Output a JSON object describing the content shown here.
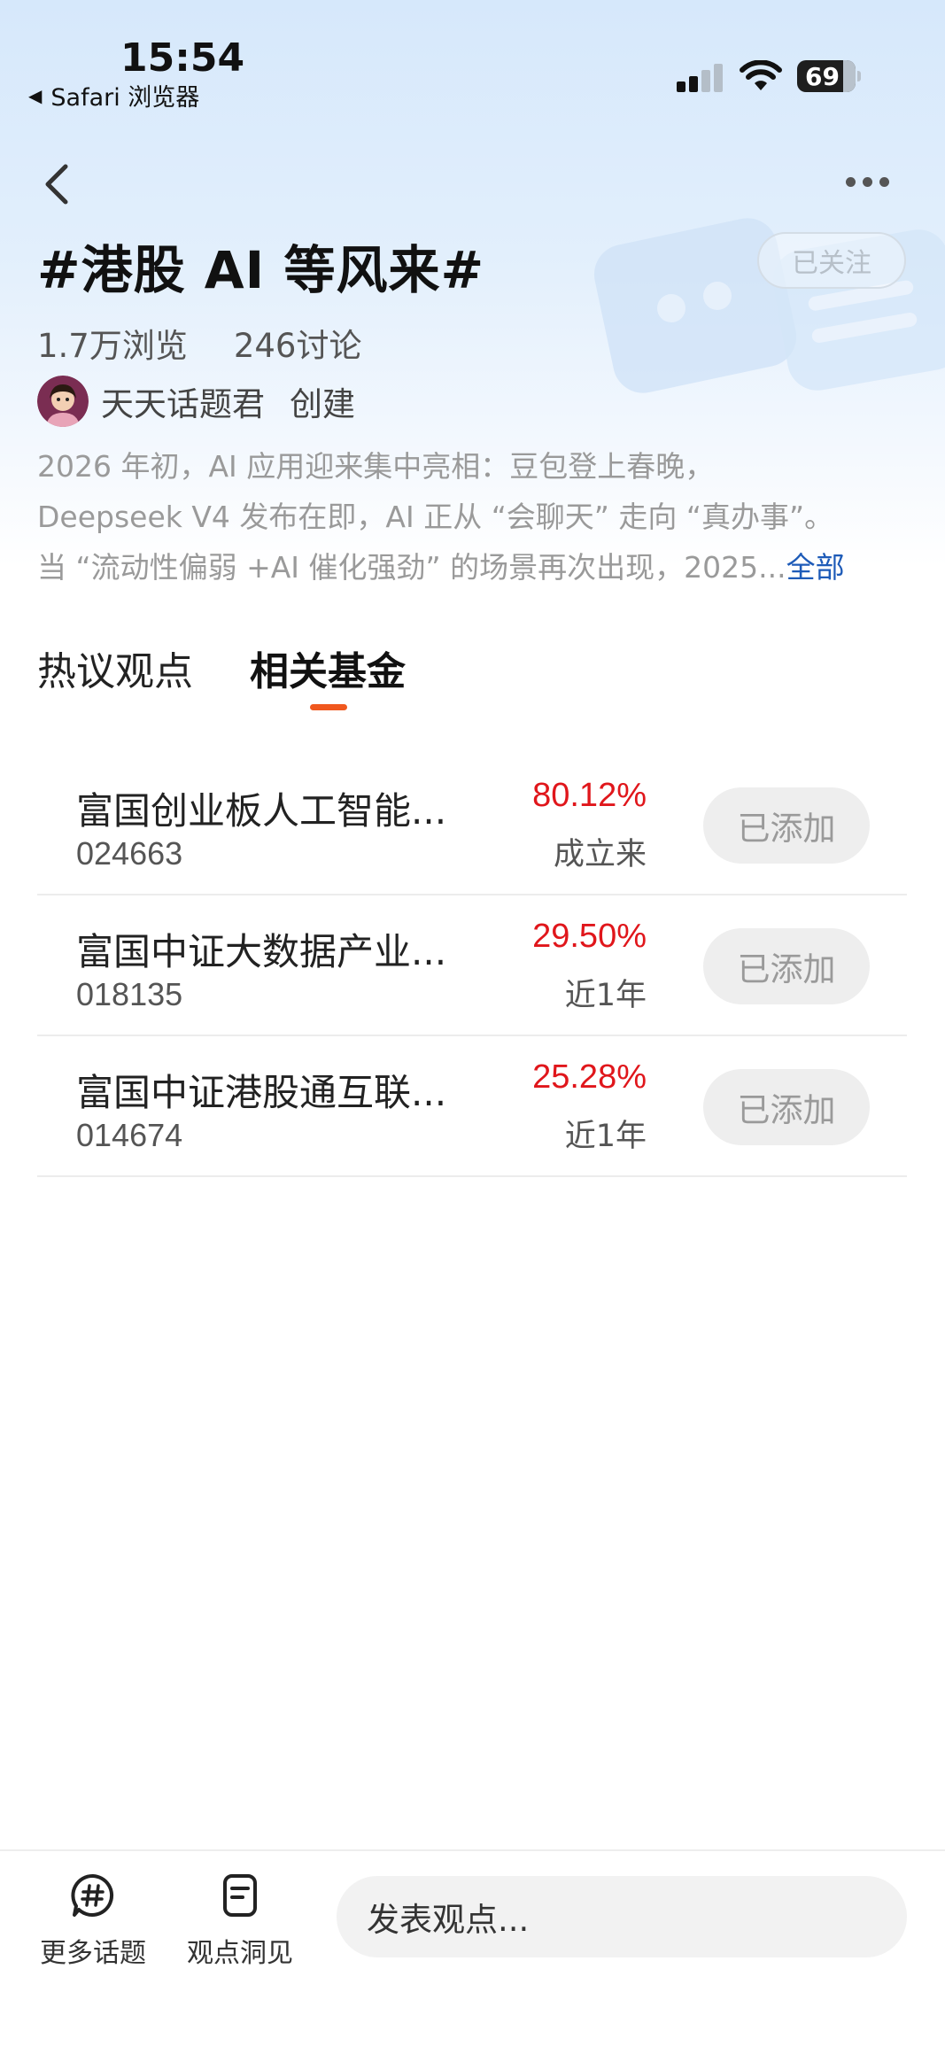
{
  "status_bar": {
    "time": "15:54",
    "back_app": "Safari 浏览器",
    "battery": "69"
  },
  "topic": {
    "title": "#港股 AI 等风来#",
    "follow_label": "已关注",
    "views": "1.7万浏览",
    "discussions": "246讨论",
    "creator_name": "天天话题君",
    "creator_suffix": "创建",
    "description": [
      "2026 年初，AI 应用迎来集中亮相：豆包登上春晚，",
      "Deepseek V4 发布在即，AI 正从 “会聊天” 走向 “真办事”。",
      "当 “流动性偏弱 +AI 催化强劲” 的场景再次出现，2025"
    ],
    "ellipsis": "...",
    "more_label": "全部"
  },
  "tabs": [
    {
      "label": "热议观点"
    },
    {
      "label": "相关基金"
    }
  ],
  "funds": [
    {
      "name": "富国创业板人工智能...",
      "code": "024663",
      "return": "80.12%",
      "period": "成立来",
      "button": "已添加"
    },
    {
      "name": "富国中证大数据产业...",
      "code": "018135",
      "return": "29.50%",
      "period": "近1年",
      "button": "已添加"
    },
    {
      "name": "富国中证港股通互联...",
      "code": "014674",
      "return": "25.28%",
      "period": "近1年",
      "button": "已添加"
    }
  ],
  "bottom_bar": {
    "more_topics": "更多话题",
    "insights": "观点洞见",
    "post_placeholder": "发表观点..."
  },
  "colors": {
    "return_red": "#e0161b",
    "tab_indicator": "#f0581e",
    "link_blue": "#1e5bb8"
  }
}
